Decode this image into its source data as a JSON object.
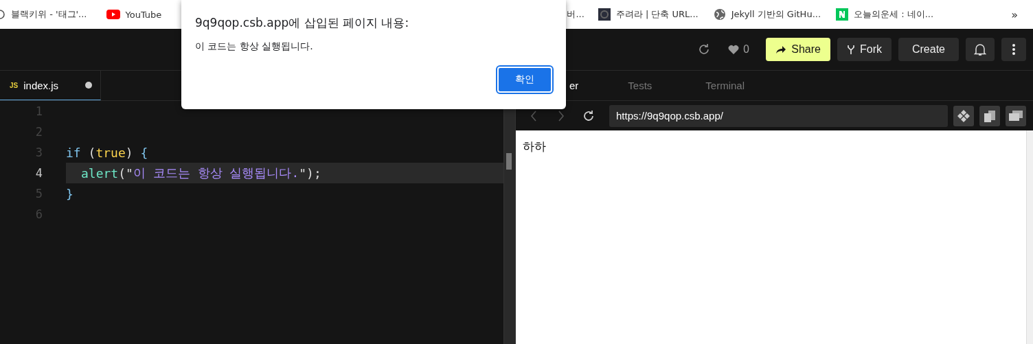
{
  "bookmarks": [
    {
      "kind": "ring",
      "label": "블랙키위 - '태그'..."
    },
    {
      "kind": "play",
      "label": "YouTube"
    },
    {
      "kind": "bare",
      "label": "버..."
    },
    {
      "kind": "square",
      "label": "주려라 | 단축 URL..."
    },
    {
      "kind": "globe",
      "label": "Jekyll 기반의 GitHu..."
    },
    {
      "kind": "letter",
      "label": "오늘의운세 : 네이..."
    }
  ],
  "bookmarks_more": "»",
  "header": {
    "likes": "0",
    "buttons": [
      {
        "kind": "share",
        "label": "Share",
        "selected": true
      },
      {
        "kind": "fork",
        "label": "Fork",
        "selected": false
      },
      {
        "kind": "plain",
        "label": "Create",
        "selected": false
      }
    ]
  },
  "editor": {
    "tab": {
      "badge": "JS",
      "label": "index.js",
      "modified": true
    },
    "lines": [
      {
        "number": "1",
        "active": false
      },
      {
        "number": "2",
        "active": false
      },
      {
        "number": "3",
        "active": false,
        "tokens": [
          {
            "kind": "keyword",
            "text": "if"
          },
          {
            "kind": "plain",
            "text": " ("
          },
          {
            "kind": "boolean",
            "text": "true"
          },
          {
            "kind": "plain",
            "text": ") "
          },
          {
            "kind": "brace",
            "text": "{"
          }
        ]
      },
      {
        "number": "4",
        "active": true,
        "indented": true,
        "tokens": [
          {
            "kind": "func",
            "text": "alert"
          },
          {
            "kind": "plain",
            "text": "(\""
          },
          {
            "kind": "string",
            "text": "이 코드는 항상 실행됩니다."
          },
          {
            "kind": "plain",
            "text": "\");"
          }
        ]
      },
      {
        "number": "5",
        "active": false,
        "tokens": [
          {
            "kind": "brace",
            "text": "}"
          }
        ]
      },
      {
        "number": "6",
        "active": false
      }
    ]
  },
  "preview": {
    "tabs": [
      {
        "label": "er",
        "selected": true
      },
      {
        "label": "Tests",
        "selected": false
      },
      {
        "label": "Terminal",
        "selected": false
      }
    ],
    "url": "https://9q9qop.csb.app/",
    "content": "하하"
  },
  "dialog": {
    "title": "9q9qop.csb.app에 삽입된 페이지 내용:",
    "message": "이 코드는 항상 실행됩니다.",
    "button": "확인"
  }
}
